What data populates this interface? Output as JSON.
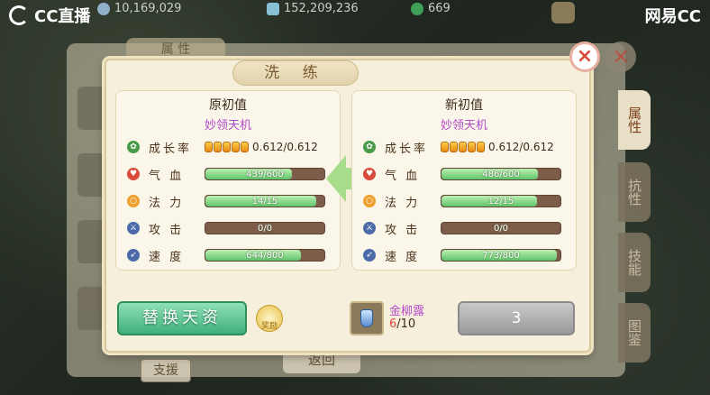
{
  "topbar": {
    "brand": "CC直播",
    "resources": [
      {
        "icon": "silver-coin-icon",
        "value": "10,169,029"
      },
      {
        "icon": "gem-icon",
        "value": "152,209,236"
      },
      {
        "icon": "jade-icon",
        "value": "669"
      }
    ],
    "watermark": "网易CC"
  },
  "background": {
    "panel_title": "属 性",
    "support_label": "支援",
    "return_label": "返回",
    "side_tabs": [
      "属性",
      "抗性",
      "技能",
      "图鉴"
    ]
  },
  "dialog": {
    "title": "洗 练",
    "close_label": "×",
    "left_card": {
      "title": "原初值",
      "subtitle": "妙领天机",
      "growth": {
        "label": "成长率",
        "value": "0.612/0.612",
        "beads": 5
      },
      "stats": [
        {
          "label": "气 血",
          "text": "439/600",
          "fill": 0.73
        },
        {
          "label": "法 力",
          "text": "14/15",
          "fill": 0.93
        },
        {
          "label": "攻 击",
          "text": "0/0",
          "fill": 0
        },
        {
          "label": "速 度",
          "text": "644/800",
          "fill": 0.8
        }
      ]
    },
    "right_card": {
      "title": "新初值",
      "subtitle": "妙领天机",
      "growth": {
        "label": "成长率",
        "value": "0.612/0.612",
        "beads": 5
      },
      "stats": [
        {
          "label": "气 血",
          "text": "486/600",
          "fill": 0.81
        },
        {
          "label": "法 力",
          "text": "12/15",
          "fill": 0.8
        },
        {
          "label": "攻 击",
          "text": "0/0",
          "fill": 0
        },
        {
          "label": "速 度",
          "text": "773/800",
          "fill": 0.97
        }
      ]
    },
    "replace_button": "替换天资",
    "badge_text": "奖励",
    "item": {
      "name": "金柳露",
      "have": "6",
      "need": "/10"
    },
    "wash_button": "3"
  },
  "colors": {
    "accent_green": "#3fb07a",
    "bar_fill": "#5fc46a",
    "purple_text": "#b44cc9",
    "close_red": "#d64b38"
  }
}
